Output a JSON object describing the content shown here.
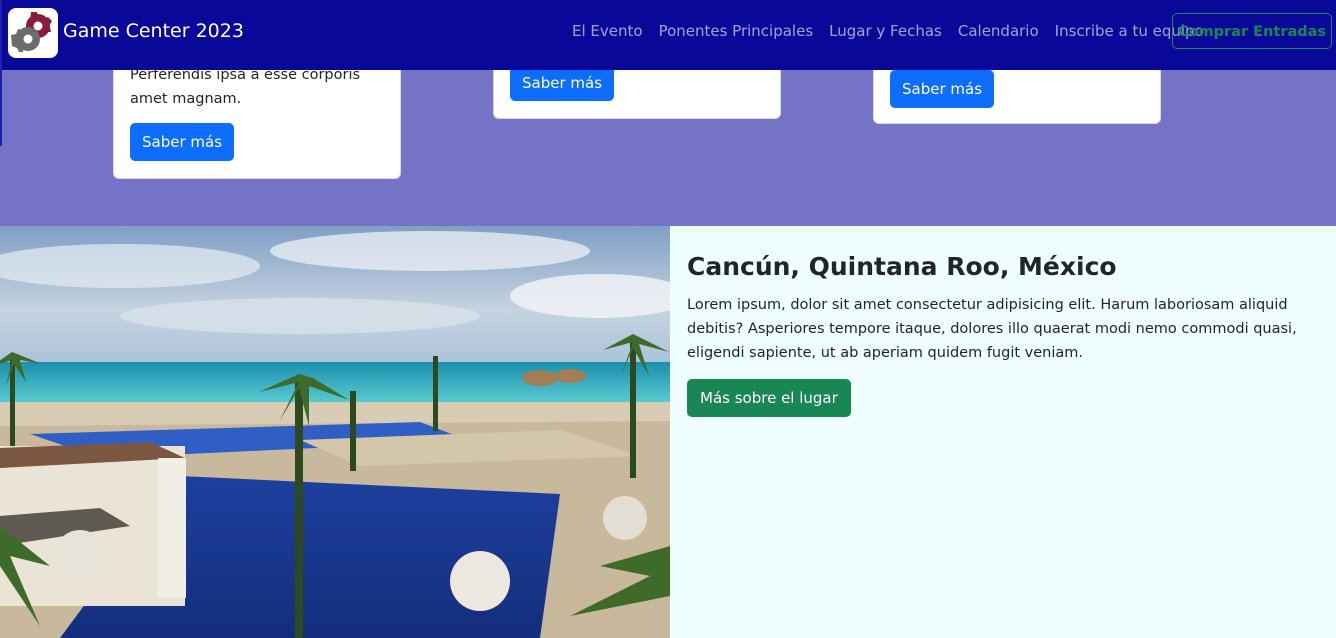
{
  "navbar": {
    "brand": "Game Center 2023",
    "links": [
      "El Evento",
      "Ponentes Principales",
      "Lugar y Fechas",
      "Calendario",
      "Inscribe a tu equipo"
    ],
    "cta": "Comprar Entradas",
    "logo_icon": "gear-icon",
    "logo_colors": [
      "#8a1c3b",
      "#6c6c6c"
    ]
  },
  "cards": [
    {
      "text_lines": [
        "Perferendis ipsa a esse corporis",
        "amet magnam."
      ],
      "button": "Saber más"
    },
    {
      "button": "Saber más"
    },
    {
      "button": "Saber más"
    }
  ],
  "location": {
    "title": "Cancún, Quintana Roo, México",
    "text": "Lorem ipsum, dolor sit amet consectetur adipisicing elit. Harum laboriosam aliquid debitis? Asperiores tempore itaque, dolores illo quaerat modi nemo commodi quasi, eligendi sapiente, ut ab aperiam quidem fugit veniam.",
    "button": "Más sobre el lugar"
  },
  "colors": {
    "navbar": "#0a0898",
    "band": "#7473c6",
    "primary": "#0d6efd",
    "success": "#198754",
    "info_bg": "#f0fefe"
  }
}
